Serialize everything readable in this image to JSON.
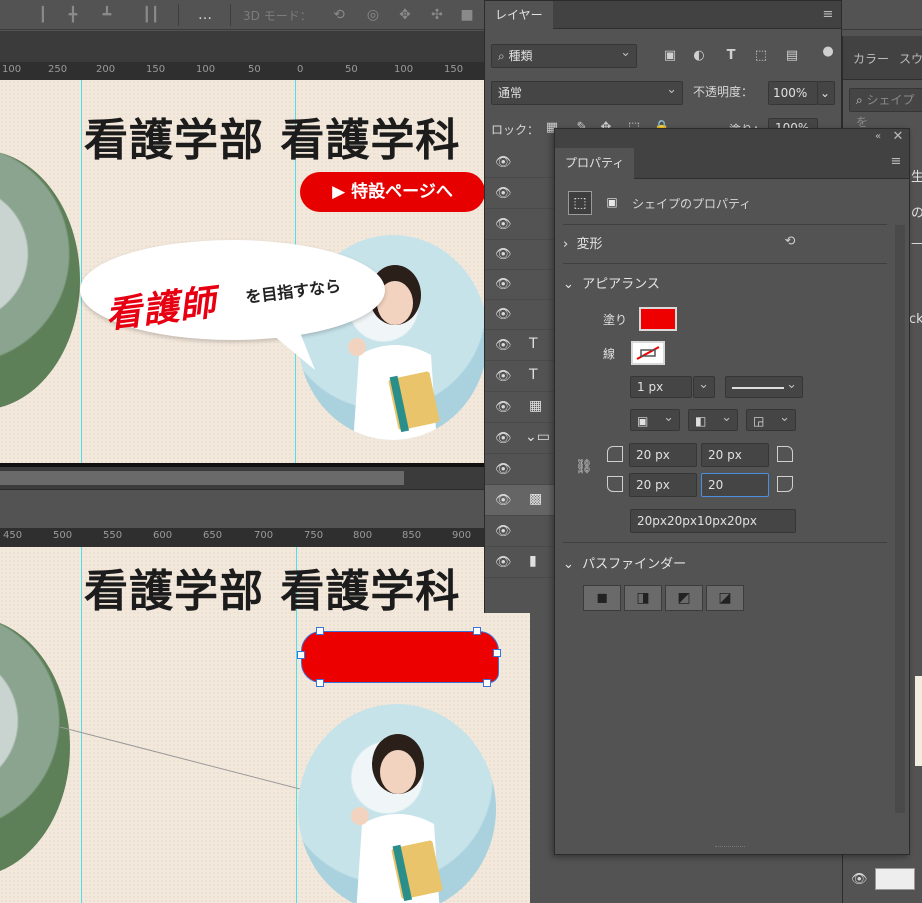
{
  "option_bar": {
    "three_d_mode_label": "3D モード：",
    "more_icon": "…"
  },
  "document_top": {
    "ruler_labels": [
      "100",
      "250",
      "200",
      "150",
      "100",
      "50",
      "0",
      "50",
      "100",
      "150",
      "200",
      "250"
    ],
    "title": "看護学部  看護学科",
    "cta_label": "▶ 特設ページへ",
    "bubble_red": "看護師",
    "bubble_dark": "を目指すなら"
  },
  "document_bottom": {
    "ruler_labels": [
      "450",
      "500",
      "550",
      "600",
      "650",
      "700",
      "750",
      "800",
      "850",
      "900"
    ],
    "title": "看護学部  看護学科"
  },
  "layers_panel": {
    "tab_label": "レイヤー",
    "filter_kind": "種類",
    "blend_mode": "通常",
    "opacity_label": "不透明度：",
    "opacity_value": "100%",
    "lock_label": "ロック：",
    "fill_label": "塗り：",
    "fill_value": "100%",
    "rows": [
      {
        "type": "shape"
      },
      {
        "type": "shape"
      },
      {
        "type": "shape"
      },
      {
        "type": "shape"
      },
      {
        "type": "shape"
      },
      {
        "type": "shape"
      },
      {
        "type": "text"
      },
      {
        "type": "text"
      },
      {
        "type": "smart"
      },
      {
        "type": "group"
      },
      {
        "type": "text-sub"
      },
      {
        "type": "smart"
      },
      {
        "type": "shape"
      },
      {
        "type": "shape"
      }
    ]
  },
  "properties_panel": {
    "tab_label": "プロパティ",
    "shape_props_label": "シェイプのプロパティ",
    "transform_label": "変形",
    "appearance_label": "アピアランス",
    "fill_label": "塗り",
    "stroke_label": "線",
    "stroke_width": "1 px",
    "corner_tl": "20 px",
    "corner_tr": "20 px",
    "corner_bl": "20 px",
    "corner_br": "20",
    "corner_summary": "20px20px10px20px",
    "pathfinder_label": "パスファインダー",
    "fill_color": "#ee0000"
  },
  "right_dock": {
    "tab_color": "カラー",
    "tab_swatch": "スウ",
    "search_placeholder": "シェイプを",
    "partial_texts": [
      "生",
      "の",
      "—",
      "ck"
    ]
  }
}
